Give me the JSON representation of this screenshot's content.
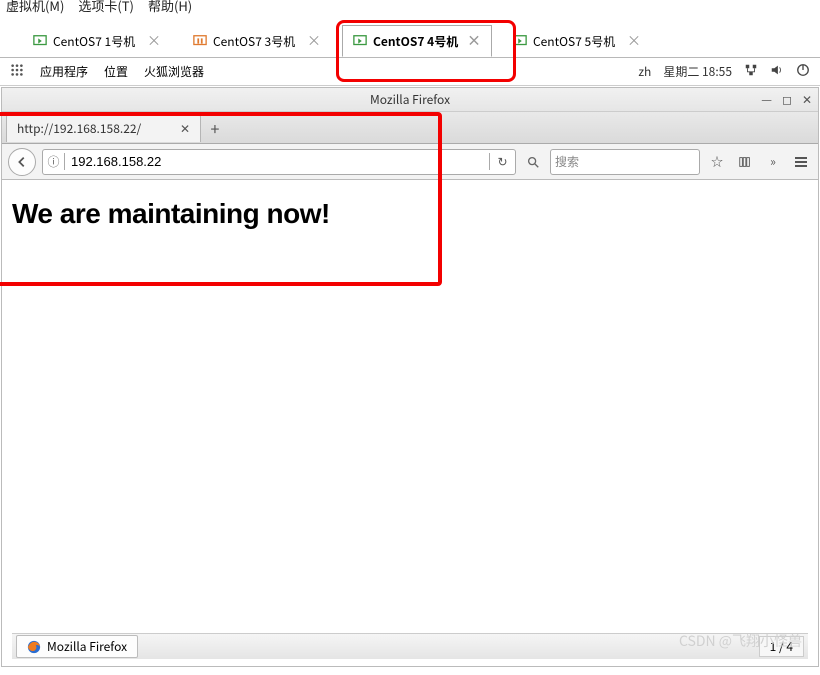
{
  "host_menu": {
    "m1": "虚拟机(M)",
    "m2": "选项卡(T)",
    "m3": "帮助(H)"
  },
  "vm_tabs": [
    {
      "label": "CentOS7 1号机",
      "active": false
    },
    {
      "label": "CentOS7 3号机",
      "active": false
    },
    {
      "label": "CentOS7 4号机",
      "active": true
    },
    {
      "label": "CentOS7 5号机",
      "active": false
    }
  ],
  "gnome": {
    "apps": "应用程序",
    "places": "位置",
    "firefox": "火狐浏览器",
    "lang": "zh",
    "clock": "星期二 18:55"
  },
  "firefox": {
    "window_title": "Mozilla Firefox",
    "tab_title": "http://192.168.158.22/",
    "url_value": "192.168.158.22",
    "search_placeholder": "搜索",
    "page_heading": "We are maintaining now!"
  },
  "taskbar": {
    "item": "Mozilla Firefox",
    "pages": "1 / 4"
  },
  "watermark": "CSDN @飞翔小怪兽"
}
